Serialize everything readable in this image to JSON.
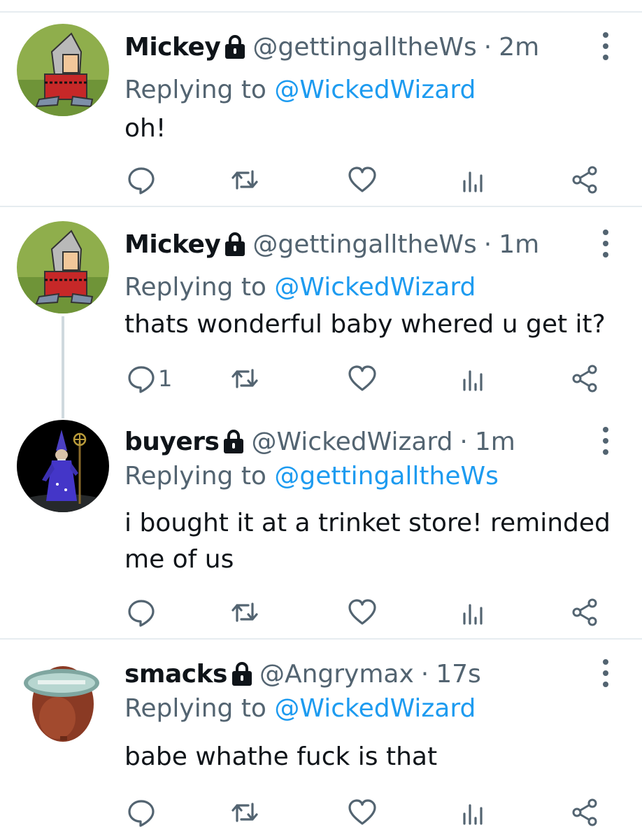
{
  "colors": {
    "text_primary": "#0f1419",
    "text_secondary": "#536471",
    "link_blue": "#1d9bf0",
    "divider": "#e6ecf0"
  },
  "tweets": [
    {
      "display_name": "Mickey",
      "handle": "@gettingalltheWs",
      "separator": "·",
      "time": "2m",
      "replying_prefix": "Replying to",
      "replying_to": "@WickedWizard",
      "text": "oh!",
      "reply_count": "",
      "avatar_icon": "knight-avatar"
    },
    {
      "display_name": "Mickey",
      "handle": "@gettingalltheWs",
      "separator": "·",
      "time": "1m",
      "replying_prefix": "Replying to",
      "replying_to": "@WickedWizard",
      "text": "thats wonderful baby whered u get it?",
      "reply_count": "1",
      "avatar_icon": "knight-avatar"
    },
    {
      "display_name": "buyers",
      "handle": "@WickedWizard",
      "separator": "·",
      "time": "1m",
      "replying_prefix": "Replying to",
      "replying_to": "@gettingalltheWs",
      "text": "i bought it at a trinket store! reminded me of us",
      "reply_count": "",
      "avatar_icon": "wizard-avatar"
    },
    {
      "display_name": "smacks",
      "handle": "@Angrymax",
      "separator": "·",
      "time": "17s",
      "replying_prefix": "Replying to",
      "replying_to": "@WickedWizard",
      "text": "babe whathe fuck is that",
      "reply_count": "",
      "avatar_icon": "red-blob-avatar"
    }
  ],
  "action_icons": [
    "reply-icon",
    "retweet-icon",
    "like-icon",
    "analytics-icon",
    "share-icon"
  ]
}
